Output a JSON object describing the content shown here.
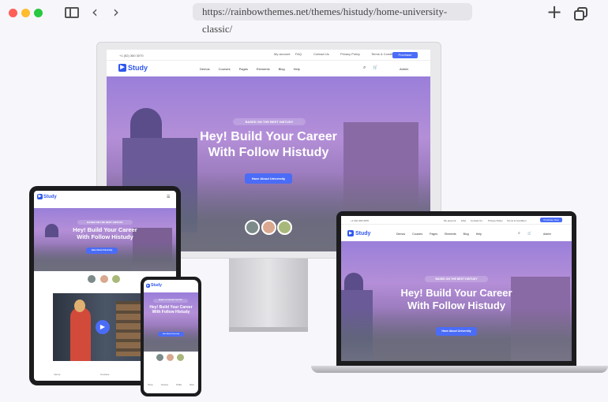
{
  "browser": {
    "url": "https://rainbowthemes.net/themes/histudy/home-university-classic/",
    "new_tab_icon": "plus-icon",
    "tabs_icon": "tab-overview-icon"
  },
  "site": {
    "brand": "Study",
    "phone": "+1 (52) 360 3070",
    "topbar_links": [
      "My account",
      "FAQ",
      "Contact Us",
      "Privacy Policy",
      "Terms & Condition"
    ],
    "purchase_label": "Purchase",
    "purchase_now_label": "Purchase Now",
    "nav": [
      "Demos",
      "Courses",
      "Pages",
      "Elements",
      "Blog",
      "Help"
    ],
    "admin_label": "Admin",
    "badge": "BASED ON THE BEST HISTUDY",
    "title_line1": "Hey! Build Your Career",
    "title_line2": "With Follow Histudy",
    "cta": "Have About University",
    "tablet_tabs": [
      "Home",
      "Courses",
      "Profile"
    ],
    "phone_tabs": [
      "Home",
      "Courses",
      "Profile",
      "More"
    ]
  },
  "colors": {
    "accent": "#2f57ef",
    "button": "#4a6cf7",
    "traffic_red": "#ff5f57",
    "traffic_yellow": "#febc2e",
    "traffic_green": "#28c840"
  }
}
